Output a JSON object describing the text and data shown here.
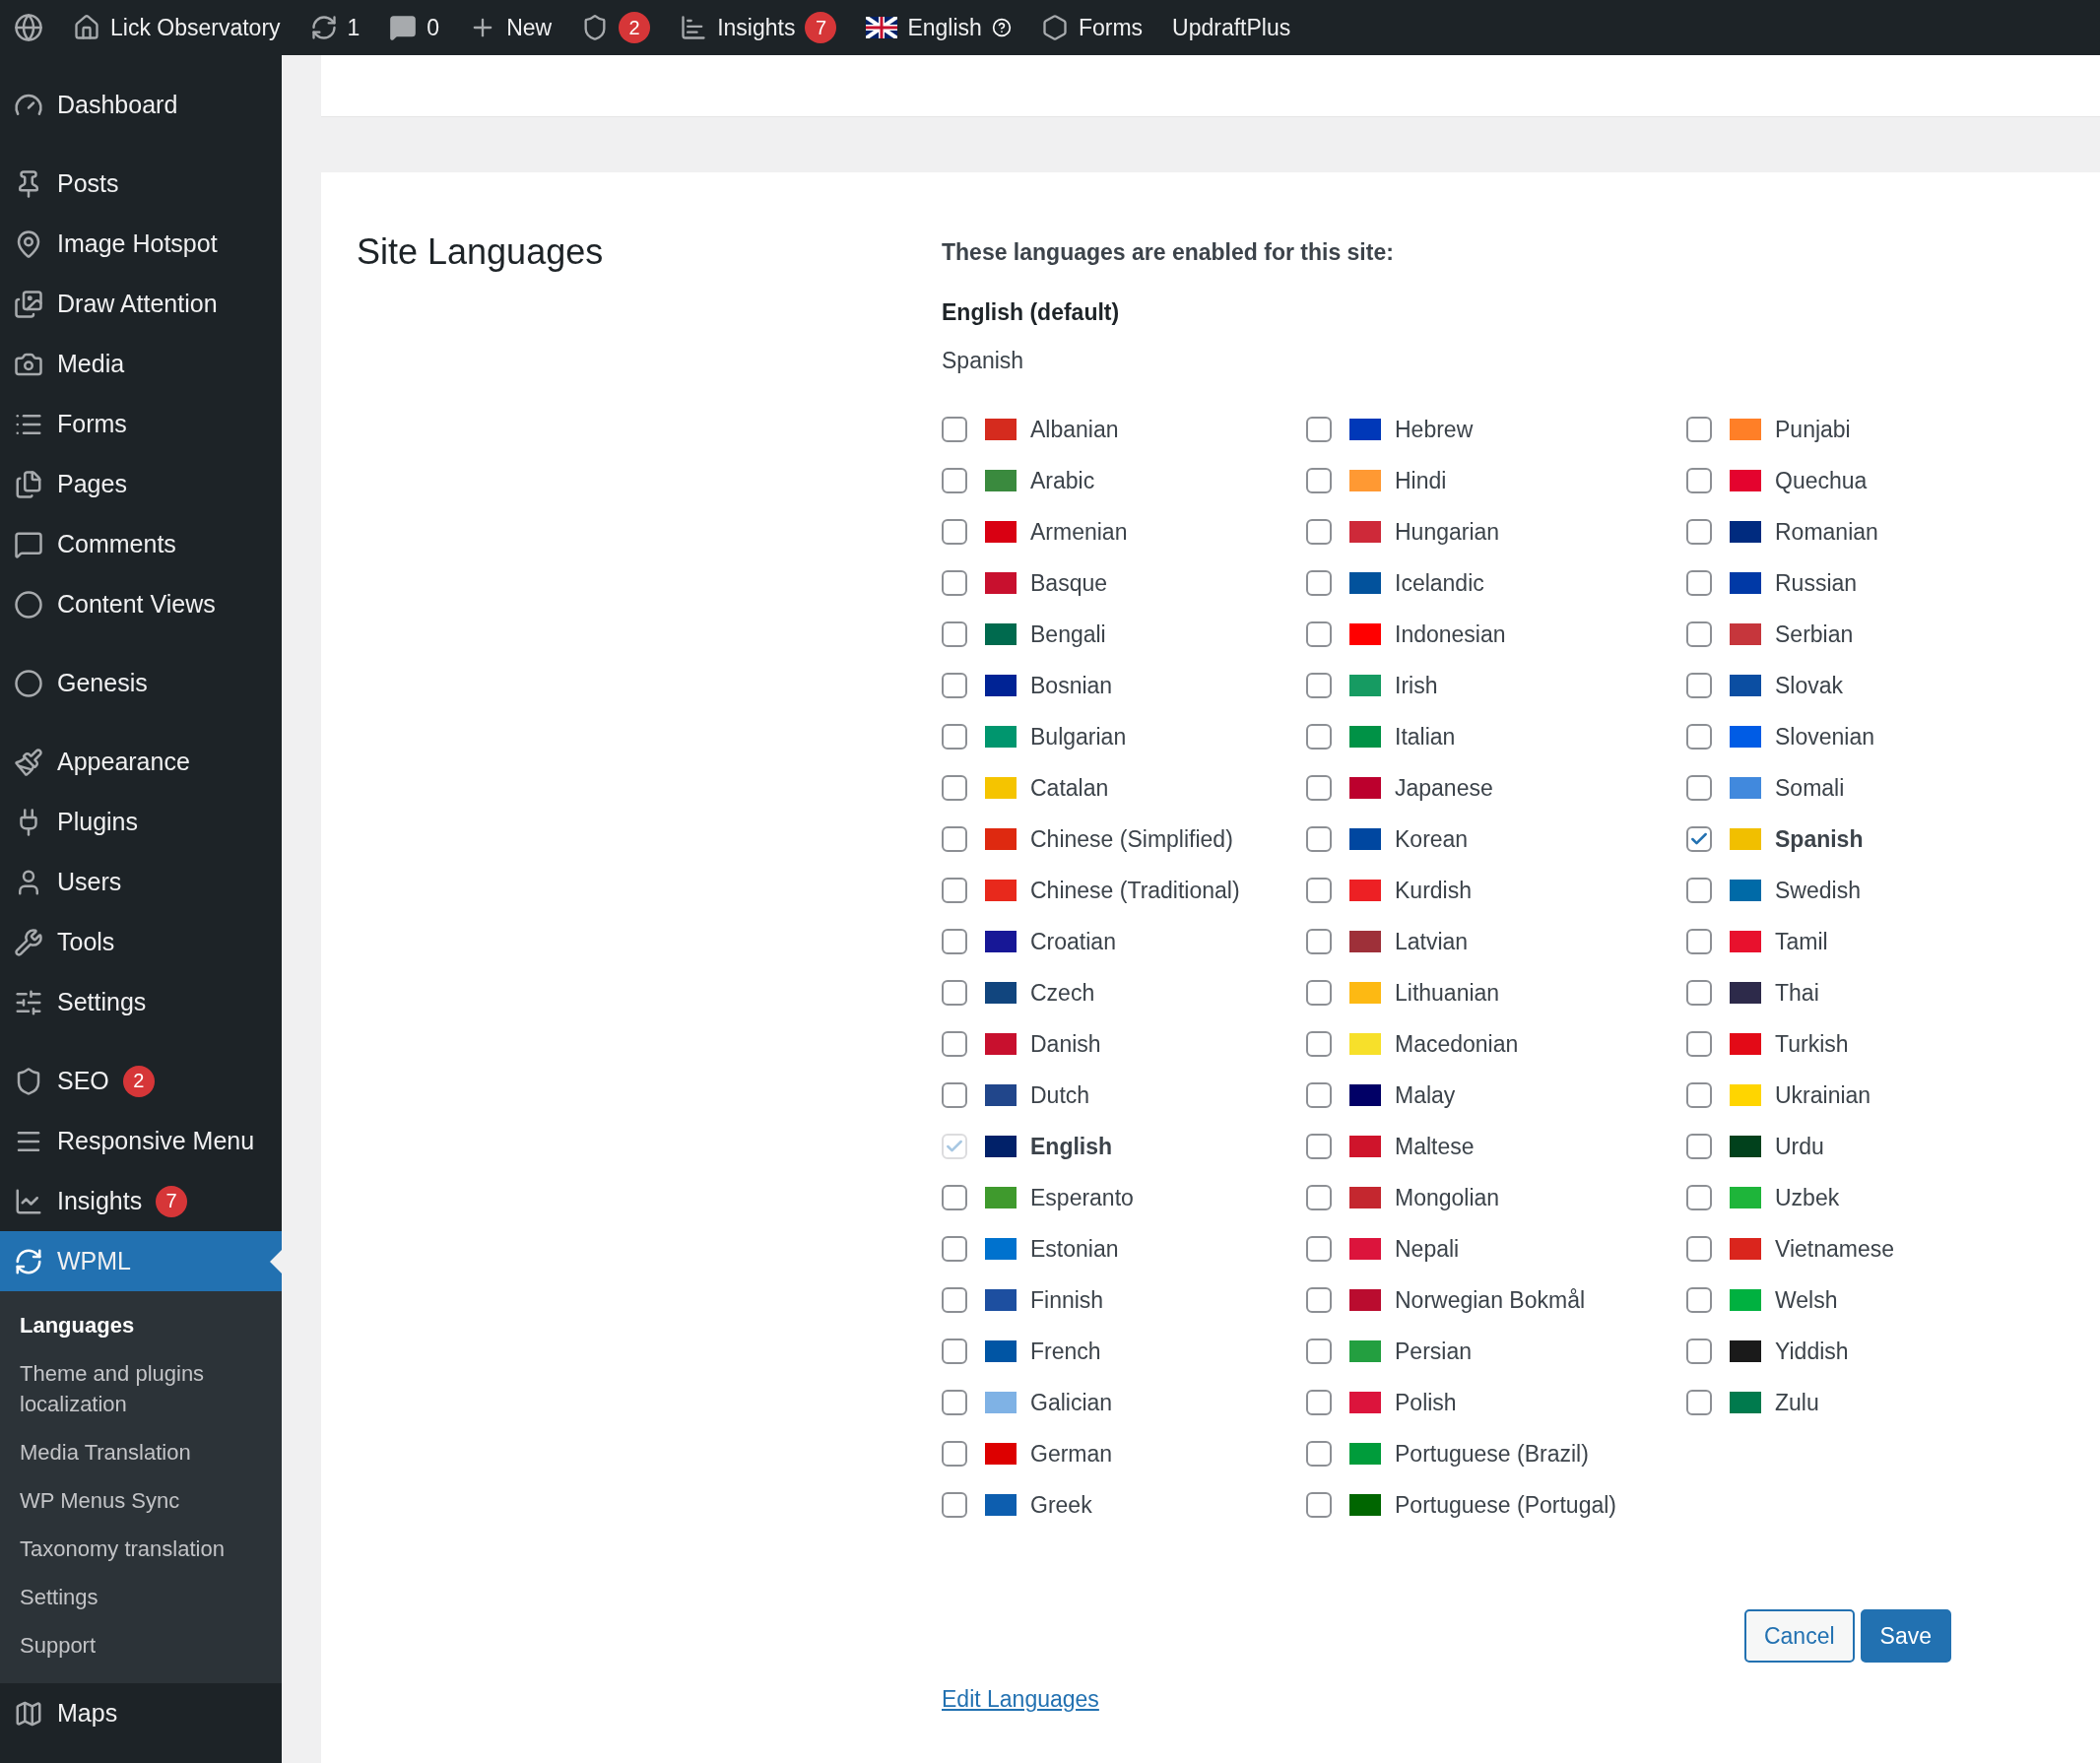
{
  "admin_bar": [
    {
      "label": "Lick Observatory"
    },
    {
      "label": "1"
    },
    {
      "label": "0"
    },
    {
      "label": "New"
    },
    {
      "badge": "2"
    },
    {
      "label": "Insights",
      "badge": "7"
    },
    {
      "label": "English"
    },
    {
      "label": "Forms"
    },
    {
      "label": "UpdraftPlus"
    }
  ],
  "sidebar": {
    "groups": [
      [
        {
          "label": "Dashboard",
          "selected": false
        }
      ],
      [
        {
          "label": "Posts",
          "selected": false
        },
        {
          "label": "Image Hotspot",
          "selected": false
        },
        {
          "label": "Draw Attention",
          "selected": false
        },
        {
          "label": "Media",
          "selected": false
        },
        {
          "label": "Forms",
          "selected": false
        },
        {
          "label": "Pages",
          "selected": false
        },
        {
          "label": "Comments",
          "selected": false
        },
        {
          "label": "Content Views",
          "selected": false
        }
      ],
      [
        {
          "label": "Genesis",
          "selected": false
        }
      ],
      [
        {
          "label": "Appearance",
          "selected": false
        },
        {
          "label": "Plugins",
          "selected": false
        },
        {
          "label": "Users",
          "selected": false
        },
        {
          "label": "Tools",
          "selected": false
        },
        {
          "label": "Settings",
          "selected": false
        }
      ],
      [
        {
          "label": "SEO",
          "badge": "2",
          "selected": false
        },
        {
          "label": "Responsive Menu",
          "selected": false
        },
        {
          "label": "Insights",
          "badge": "7",
          "selected": false
        },
        {
          "label": "WPML",
          "selected": true,
          "submenu": [
            {
              "label": "Languages",
              "selected": true
            },
            {
              "label": "Theme and plugins localization",
              "selected": false
            },
            {
              "label": "Media Translation",
              "selected": false
            },
            {
              "label": "WP Menus Sync",
              "selected": false
            },
            {
              "label": "Taxonomy translation",
              "selected": false
            },
            {
              "label": "Settings",
              "selected": false
            },
            {
              "label": "Support",
              "selected": false
            }
          ]
        },
        {
          "label": "Maps",
          "selected": false
        }
      ]
    ]
  },
  "section": {
    "title": "Site Languages",
    "intro": "These languages are enabled for this site:",
    "default_language": "English (default)",
    "enabled_languages": [
      "Spanish"
    ],
    "languages": [
      [
        {
          "name": "Albanian",
          "checked": false,
          "disabled": false,
          "color": "#d52b1e"
        },
        {
          "name": "Arabic",
          "checked": false,
          "disabled": false,
          "color": "#3a8a3e"
        },
        {
          "name": "Armenian",
          "checked": false,
          "disabled": false,
          "color": "#d90012"
        },
        {
          "name": "Basque",
          "checked": false,
          "disabled": false,
          "color": "#c8102e"
        },
        {
          "name": "Bengali",
          "checked": false,
          "disabled": false,
          "color": "#006a4e"
        },
        {
          "name": "Bosnian",
          "checked": false,
          "disabled": false,
          "color": "#002395"
        },
        {
          "name": "Bulgarian",
          "checked": false,
          "disabled": false,
          "color": "#00966e"
        },
        {
          "name": "Catalan",
          "checked": false,
          "disabled": false,
          "color": "#f5c400"
        },
        {
          "name": "Chinese (Simplified)",
          "checked": false,
          "disabled": false,
          "color": "#de2910"
        },
        {
          "name": "Chinese (Traditional)",
          "checked": false,
          "disabled": false,
          "color": "#e8291c"
        },
        {
          "name": "Croatian",
          "checked": false,
          "disabled": false,
          "color": "#171796"
        },
        {
          "name": "Czech",
          "checked": false,
          "disabled": false,
          "color": "#11457e"
        },
        {
          "name": "Danish",
          "checked": false,
          "disabled": false,
          "color": "#c8102e"
        },
        {
          "name": "Dutch",
          "checked": false,
          "disabled": false,
          "color": "#21468b"
        },
        {
          "name": "English",
          "checked": true,
          "disabled": true,
          "color": "#012169"
        },
        {
          "name": "Esperanto",
          "checked": false,
          "disabled": false,
          "color": "#3f9a2d"
        },
        {
          "name": "Estonian",
          "checked": false,
          "disabled": false,
          "color": "#0072ce"
        },
        {
          "name": "Finnish",
          "checked": false,
          "disabled": false,
          "color": "#1d4fa0"
        },
        {
          "name": "French",
          "checked": false,
          "disabled": false,
          "color": "#0055a4"
        },
        {
          "name": "Galician",
          "checked": false,
          "disabled": false,
          "color": "#7fb2e5"
        },
        {
          "name": "German",
          "checked": false,
          "disabled": false,
          "color": "#dd0000"
        },
        {
          "name": "Greek",
          "checked": false,
          "disabled": false,
          "color": "#0d5eaf"
        }
      ],
      [
        {
          "name": "Hebrew",
          "checked": false,
          "disabled": false,
          "color": "#0038b8"
        },
        {
          "name": "Hindi",
          "checked": false,
          "disabled": false,
          "color": "#ff9933"
        },
        {
          "name": "Hungarian",
          "checked": false,
          "disabled": false,
          "color": "#ce2939"
        },
        {
          "name": "Icelandic",
          "checked": false,
          "disabled": false,
          "color": "#02529c"
        },
        {
          "name": "Indonesian",
          "checked": false,
          "disabled": false,
          "color": "#ff0000"
        },
        {
          "name": "Irish",
          "checked": false,
          "disabled": false,
          "color": "#169b62"
        },
        {
          "name": "Italian",
          "checked": false,
          "disabled": false,
          "color": "#009246"
        },
        {
          "name": "Japanese",
          "checked": false,
          "disabled": false,
          "color": "#bc002d"
        },
        {
          "name": "Korean",
          "checked": false,
          "disabled": false,
          "color": "#0047a0"
        },
        {
          "name": "Kurdish",
          "checked": false,
          "disabled": false,
          "color": "#ed2024"
        },
        {
          "name": "Latvian",
          "checked": false,
          "disabled": false,
          "color": "#9e3039"
        },
        {
          "name": "Lithuanian",
          "checked": false,
          "disabled": false,
          "color": "#fdb913"
        },
        {
          "name": "Macedonian",
          "checked": false,
          "disabled": false,
          "color": "#f7e02a"
        },
        {
          "name": "Malay",
          "checked": false,
          "disabled": false,
          "color": "#010066"
        },
        {
          "name": "Maltese",
          "checked": false,
          "disabled": false,
          "color": "#cf142b"
        },
        {
          "name": "Mongolian",
          "checked": false,
          "disabled": false,
          "color": "#c4272f"
        },
        {
          "name": "Nepali",
          "checked": false,
          "disabled": false,
          "color": "#dc143c"
        },
        {
          "name": "Norwegian Bokmål",
          "checked": false,
          "disabled": false,
          "color": "#ba0c2f"
        },
        {
          "name": "Persian",
          "checked": false,
          "disabled": false,
          "color": "#239f40"
        },
        {
          "name": "Polish",
          "checked": false,
          "disabled": false,
          "color": "#dc143c"
        },
        {
          "name": "Portuguese (Brazil)",
          "checked": false,
          "disabled": false,
          "color": "#009c3b"
        },
        {
          "name": "Portuguese (Portugal)",
          "checked": false,
          "disabled": false,
          "color": "#006600"
        }
      ],
      [
        {
          "name": "Punjabi",
          "checked": false,
          "disabled": false,
          "color": "#ff7f27"
        },
        {
          "name": "Quechua",
          "checked": false,
          "disabled": false,
          "color": "#e4032e"
        },
        {
          "name": "Romanian",
          "checked": false,
          "disabled": false,
          "color": "#002b7f"
        },
        {
          "name": "Russian",
          "checked": false,
          "disabled": false,
          "color": "#0039a6"
        },
        {
          "name": "Serbian",
          "checked": false,
          "disabled": false,
          "color": "#c6363c"
        },
        {
          "name": "Slovak",
          "checked": false,
          "disabled": false,
          "color": "#0b4ea2"
        },
        {
          "name": "Slovenian",
          "checked": false,
          "disabled": false,
          "color": "#005ce5"
        },
        {
          "name": "Somali",
          "checked": false,
          "disabled": false,
          "color": "#4189dd"
        },
        {
          "name": "Spanish",
          "checked": true,
          "disabled": false,
          "color": "#f1bf00"
        },
        {
          "name": "Swedish",
          "checked": false,
          "disabled": false,
          "color": "#006aa7"
        },
        {
          "name": "Tamil",
          "checked": false,
          "disabled": false,
          "color": "#e8112d"
        },
        {
          "name": "Thai",
          "checked": false,
          "disabled": false,
          "color": "#2d2a4a"
        },
        {
          "name": "Turkish",
          "checked": false,
          "disabled": false,
          "color": "#e30a17"
        },
        {
          "name": "Ukrainian",
          "checked": false,
          "disabled": false,
          "color": "#ffd500"
        },
        {
          "name": "Urdu",
          "checked": false,
          "disabled": false,
          "color": "#01411c"
        },
        {
          "name": "Uzbek",
          "checked": false,
          "disabled": false,
          "color": "#1eb53a"
        },
        {
          "name": "Vietnamese",
          "checked": false,
          "disabled": false,
          "color": "#da251d"
        },
        {
          "name": "Welsh",
          "checked": false,
          "disabled": false,
          "color": "#00b140"
        },
        {
          "name": "Yiddish",
          "checked": false,
          "disabled": false,
          "color": "#1a1a1a"
        },
        {
          "name": "Zulu",
          "checked": false,
          "disabled": false,
          "color": "#007a4d"
        }
      ]
    ],
    "buttons": [
      {
        "label": "Cancel",
        "kind": "secondary"
      },
      {
        "label": "Save",
        "kind": "primary"
      }
    ],
    "link": "Edit Languages"
  }
}
